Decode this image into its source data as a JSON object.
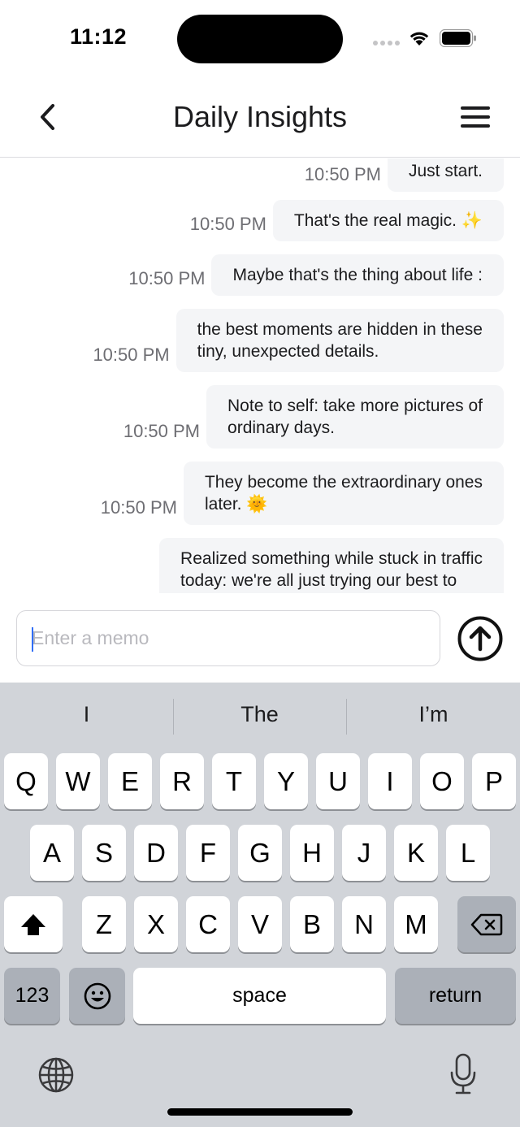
{
  "status_bar": {
    "time": "11:12"
  },
  "header": {
    "title": "Daily Insights"
  },
  "messages": [
    {
      "time": "10:50 PM",
      "lines": [
        "Just start."
      ]
    },
    {
      "time": "10:50 PM",
      "lines": [
        "That's the real magic. ✨"
      ]
    },
    {
      "time": "10:50 PM",
      "lines": [
        "Maybe that's the thing about life :"
      ]
    },
    {
      "time": "10:50 PM",
      "lines": [
        "the best moments are hidden in these",
        "tiny, unexpected details."
      ]
    },
    {
      "time": "10:50 PM",
      "lines": [
        "Note to self: take more pictures of",
        "ordinary days."
      ]
    },
    {
      "time": "10:50 PM",
      "lines": [
        "They become the extraordinary ones",
        "later. 🌞"
      ]
    },
    {
      "time": "",
      "lines": [
        "Realized something while stuck in traffic",
        "today: we're all just trying our best to"
      ]
    }
  ],
  "input": {
    "placeholder": "Enter a memo",
    "value": ""
  },
  "keyboard": {
    "suggestions": [
      "I",
      "The",
      "I’m"
    ],
    "row1": [
      "Q",
      "W",
      "E",
      "R",
      "T",
      "Y",
      "U",
      "I",
      "O",
      "P"
    ],
    "row2": [
      "A",
      "S",
      "D",
      "F",
      "G",
      "H",
      "J",
      "K",
      "L"
    ],
    "row3": [
      "Z",
      "X",
      "C",
      "V",
      "B",
      "N",
      "M"
    ],
    "numbers_label": "123",
    "space_label": "space",
    "return_label": "return"
  },
  "icons": {
    "back": "chevron-left-icon",
    "menu": "hamburger-menu-icon",
    "send": "arrow-up-circle-icon",
    "shift": "shift-icon",
    "delete": "backspace-icon",
    "emoji": "emoji-icon",
    "globe": "globe-icon",
    "mic": "microphone-icon"
  },
  "colors": {
    "caret": "#2f6df6",
    "bubble": "#f4f5f7",
    "keyboard_bg": "#d1d4d9"
  }
}
